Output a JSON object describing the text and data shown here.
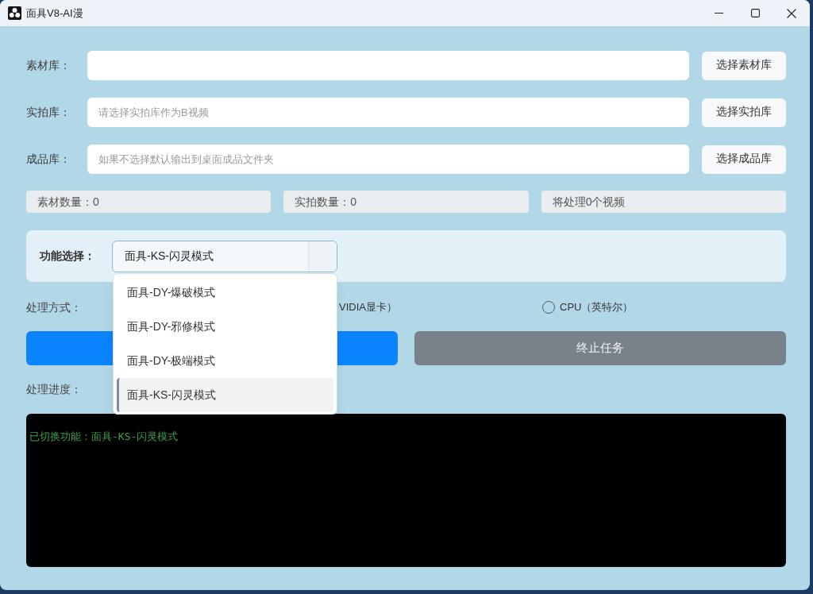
{
  "window": {
    "title": "面具V8-AI漫"
  },
  "paths": [
    {
      "label": "素材库：",
      "button": "选择素材库"
    },
    {
      "label": "实拍库：",
      "placeholder": "请选择实拍库作为B视频",
      "button": "选择实拍库"
    },
    {
      "label": "成品库：",
      "placeholder": "如果不选择默认输出到桌面成品文件夹",
      "button": "选择成品库"
    }
  ],
  "stats": [
    "素材数量：0",
    "实拍数量：0",
    "将处理0个视频"
  ],
  "function_select": {
    "label": "功能选择：",
    "value": "面具-KS-闪灵模式",
    "expanded": true,
    "options": [
      {
        "label": "面具-DY-爆破模式",
        "selected": false
      },
      {
        "label": "面具-DY-邪修模式",
        "selected": false
      },
      {
        "label": "面具-DY-极端模式",
        "selected": false
      },
      {
        "label": "面具-KS-闪灵模式",
        "selected": true
      }
    ]
  },
  "processing_mode": {
    "label": "处理方式：",
    "partial_option": "VIDIA显卡）",
    "options": [
      {
        "label": "CPU（英特尔）",
        "checked": false
      }
    ]
  },
  "action_buttons": [
    {
      "kind": "primary"
    },
    {
      "kind": "secondary",
      "label": "终止任务"
    }
  ],
  "progress": {
    "label": "处理进度："
  },
  "log": {
    "lines": [
      "已切换功能：面具-KS-闪灵模式"
    ]
  }
}
